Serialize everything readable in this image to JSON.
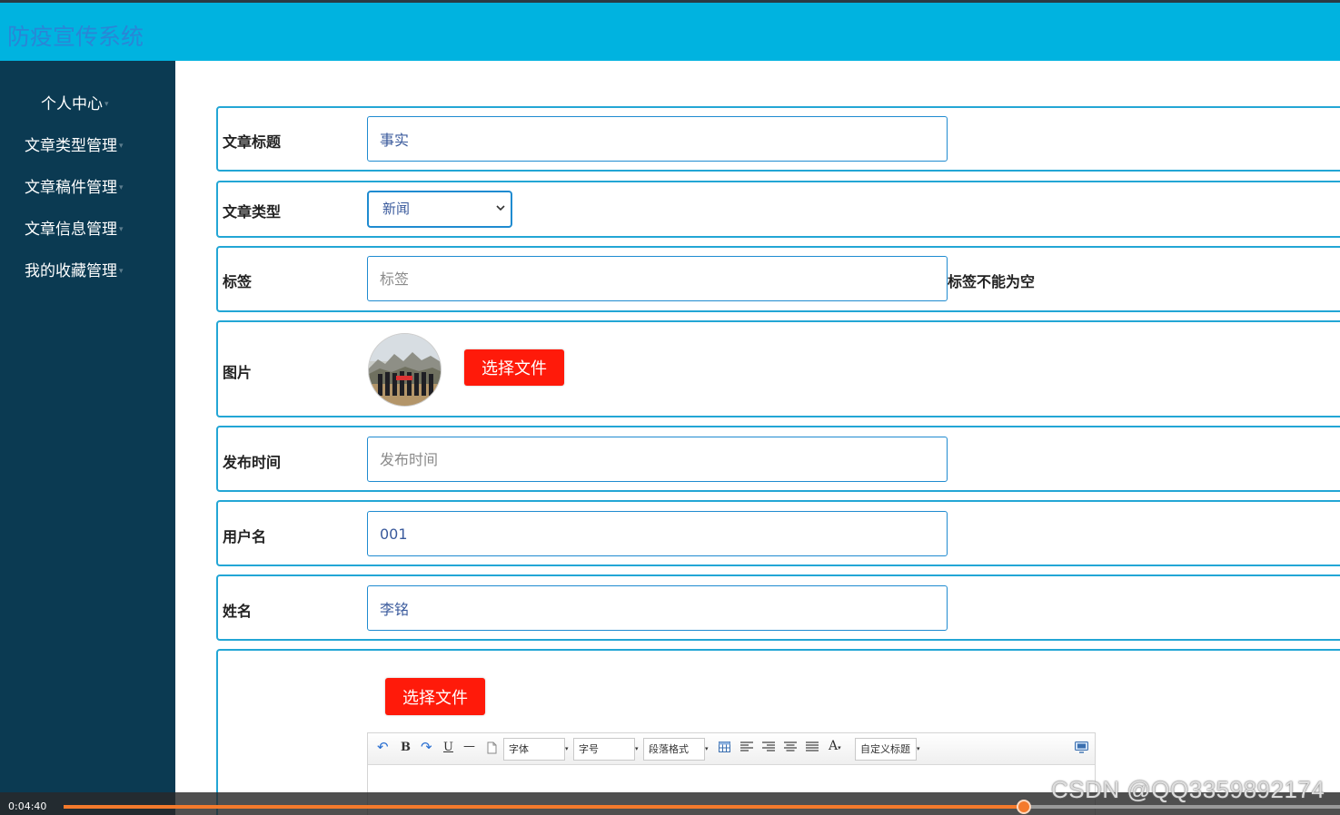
{
  "app": {
    "title": "防疫宣传系统"
  },
  "sidebar": {
    "items": [
      {
        "label": "个人中心"
      },
      {
        "label": "文章类型管理"
      },
      {
        "label": "文章稿件管理"
      },
      {
        "label": "文章信息管理"
      },
      {
        "label": "我的收藏管理"
      }
    ],
    "caret": "▾"
  },
  "form": {
    "title": {
      "label": "文章标题",
      "value": "事实"
    },
    "type": {
      "label": "文章类型",
      "selected": "新闻"
    },
    "tags": {
      "label": "标签",
      "placeholder": "标签",
      "error": "标签不能为空"
    },
    "image": {
      "label": "图片",
      "button": "选择文件"
    },
    "publish_time": {
      "label": "发布时间",
      "placeholder": "发布时间"
    },
    "username": {
      "label": "用户名",
      "value": "001"
    },
    "name": {
      "label": "姓名",
      "value": "李铭"
    },
    "content": {
      "button": "选择文件"
    }
  },
  "editor": {
    "toolbar": {
      "undo": "↶",
      "bold": "B",
      "redo": "↷",
      "underline": "U",
      "hr": "—",
      "font": "字体",
      "size": "字号",
      "paragraph": "段落格式",
      "font_color": "A",
      "custom_title": "自定义标题",
      "dropdown_arrow": "▾"
    }
  },
  "player": {
    "time": "0:04:40",
    "progress": 0.752
  },
  "watermark": "CSDN @QQ3359892174"
}
